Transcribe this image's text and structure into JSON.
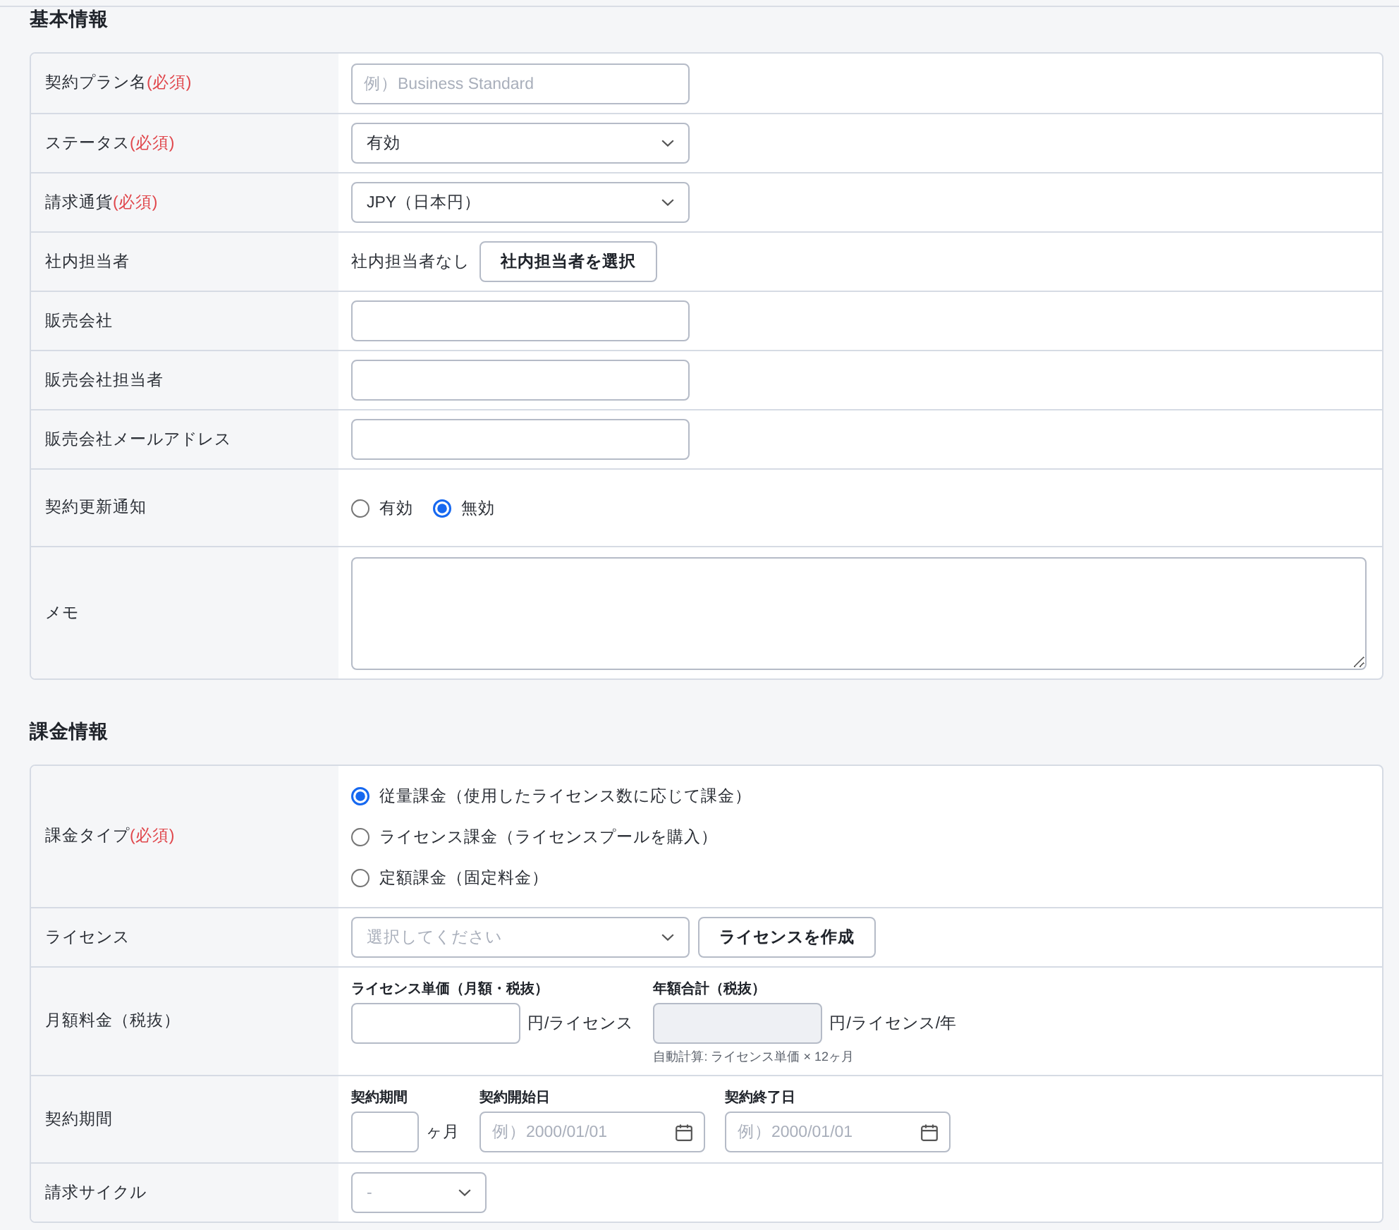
{
  "sections": [
    {
      "title": "基本情報",
      "rows": [
        {
          "kind": "input",
          "label": "契約プラン名",
          "required": "(必須)",
          "placeholder": "例）Business Standard"
        },
        {
          "kind": "select",
          "label": "ステータス",
          "required": "(必須)",
          "value": "有効"
        },
        {
          "kind": "select",
          "label": "請求通貨",
          "required": "(必須)",
          "value": "JPY（日本円）"
        },
        {
          "kind": "person",
          "label": "社内担当者",
          "text": "社内担当者なし",
          "button": "社内担当者を選択"
        },
        {
          "kind": "input",
          "label": "販売会社"
        },
        {
          "kind": "input",
          "label": "販売会社担当者"
        },
        {
          "kind": "input",
          "label": "販売会社メールアドレス"
        },
        {
          "kind": "radio_inline",
          "label": "契約更新通知",
          "options": [
            {
              "label": "有効",
              "selected": false
            },
            {
              "label": "無効",
              "selected": true
            }
          ]
        },
        {
          "kind": "textarea",
          "label": "メモ"
        }
      ]
    },
    {
      "title": "課金情報",
      "rows": [
        {
          "kind": "radio_stack",
          "label": "課金タイプ",
          "required": "(必須)",
          "options": [
            {
              "label": "従量課金（使用したライセンス数に応じて課金）",
              "selected": true
            },
            {
              "label": "ライセンス課金（ライセンスプールを購入）",
              "selected": false
            },
            {
              "label": "定額課金（固定料金）",
              "selected": false
            }
          ]
        },
        {
          "kind": "select_button",
          "label": "ライセンス",
          "placeholder": "選択してください",
          "button": "ライセンスを作成"
        },
        {
          "kind": "fields",
          "label": "月額料金（税抜）",
          "fields": [
            {
              "kind": "amount",
              "caption": "ライセンス単価（月額・税抜）",
              "unit": "円/ライセンス",
              "disabled": false
            },
            {
              "kind": "amount",
              "caption": "年額合計（税抜）",
              "unit": "円/ライセンス/年",
              "disabled": true,
              "hint": "自動計算: ライセンス単価 × 12ヶ月"
            }
          ]
        },
        {
          "kind": "fields",
          "label": "契約期間",
          "fields": [
            {
              "kind": "months",
              "caption": "契約期間",
              "unit": "ヶ月",
              "disabled": false
            },
            {
              "kind": "date",
              "caption": "契約開始日",
              "placeholder": "例）2000/01/01",
              "disabled": false
            },
            {
              "kind": "date",
              "caption": "契約終了日",
              "placeholder": "例）2000/01/01",
              "disabled": false
            }
          ]
        },
        {
          "kind": "short_select",
          "label": "請求サイクル",
          "placeholder": "-"
        }
      ]
    }
  ]
}
